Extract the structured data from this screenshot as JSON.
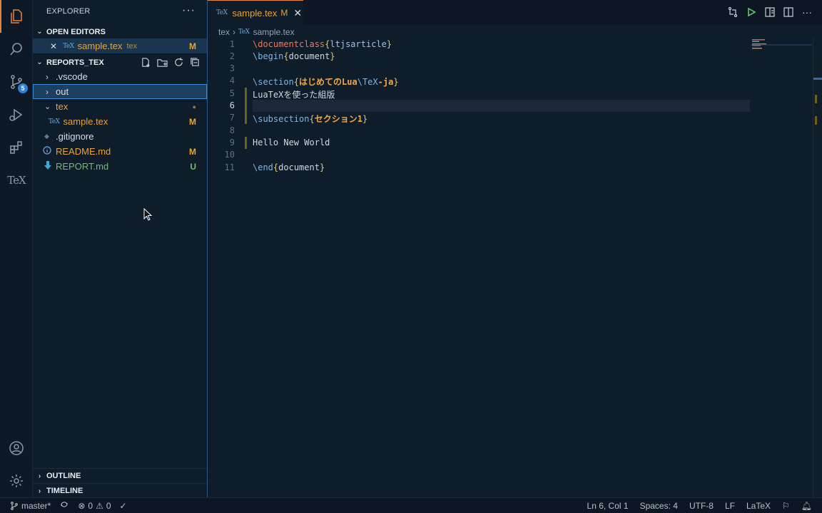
{
  "activity": {
    "scm_badge": "5",
    "tex_label": "TeX"
  },
  "explorer": {
    "title": "EXPLORER",
    "more": "···",
    "open_editors": {
      "header": "OPEN EDITORS",
      "items": [
        {
          "close": "✕",
          "icon": "TeX",
          "name": "sample.tex",
          "folder": "tex",
          "status": "M"
        }
      ]
    },
    "workspace": {
      "header": "REPORTS_TEX",
      "items": [
        {
          "name": ".vscode"
        },
        {
          "name": "out"
        },
        {
          "name": "tex",
          "status": "●"
        },
        {
          "name": "sample.tex",
          "icon": "TeX",
          "status": "M"
        },
        {
          "name": ".gitignore"
        },
        {
          "name": "README.md",
          "status": "M"
        },
        {
          "name": "REPORT.md",
          "status": "U"
        }
      ]
    },
    "outline": "OUTLINE",
    "timeline": "TIMELINE"
  },
  "editor": {
    "tab": {
      "icon": "TeX",
      "name": "sample.tex",
      "modified": "M",
      "close": "✕"
    },
    "breadcrumb": {
      "folder": "tex",
      "sep": "›",
      "icon": "TeX",
      "file": "sample.tex"
    },
    "line_numbers": [
      "1",
      "2",
      "3",
      "4",
      "5",
      "6",
      "7",
      "8",
      "9",
      "10",
      "11"
    ],
    "lines": {
      "l1_cmd": "\\documentclass",
      "l1_o": "{",
      "l1_arg": "ltjsarticle",
      "l1_c": "}",
      "l2_cmd": "\\begin",
      "l2_o": "{",
      "l2_arg": "document",
      "l2_c": "}",
      "l4_cmd": "\\section",
      "l4_o": "{",
      "l4_a": "はじめてのLua",
      "l4_b": "\\TeX",
      "l4_cc": "-ja",
      "l4_c": "}",
      "l5": "LuaTeXを使った組版",
      "l7_cmd": "\\subsection",
      "l7_o": "{",
      "l7_arg": "セクション1",
      "l7_c": "}",
      "l9": "Hello New World",
      "l11_cmd": "\\end",
      "l11_o": "{",
      "l11_arg": "document",
      "l11_c": "}"
    }
  },
  "status": {
    "branch": "master*",
    "errors": "0",
    "warnings": "0",
    "position": "Ln 6, Col 1",
    "spaces": "Spaces: 4",
    "encoding": "UTF-8",
    "eol": "LF",
    "language": "LaTeX"
  }
}
